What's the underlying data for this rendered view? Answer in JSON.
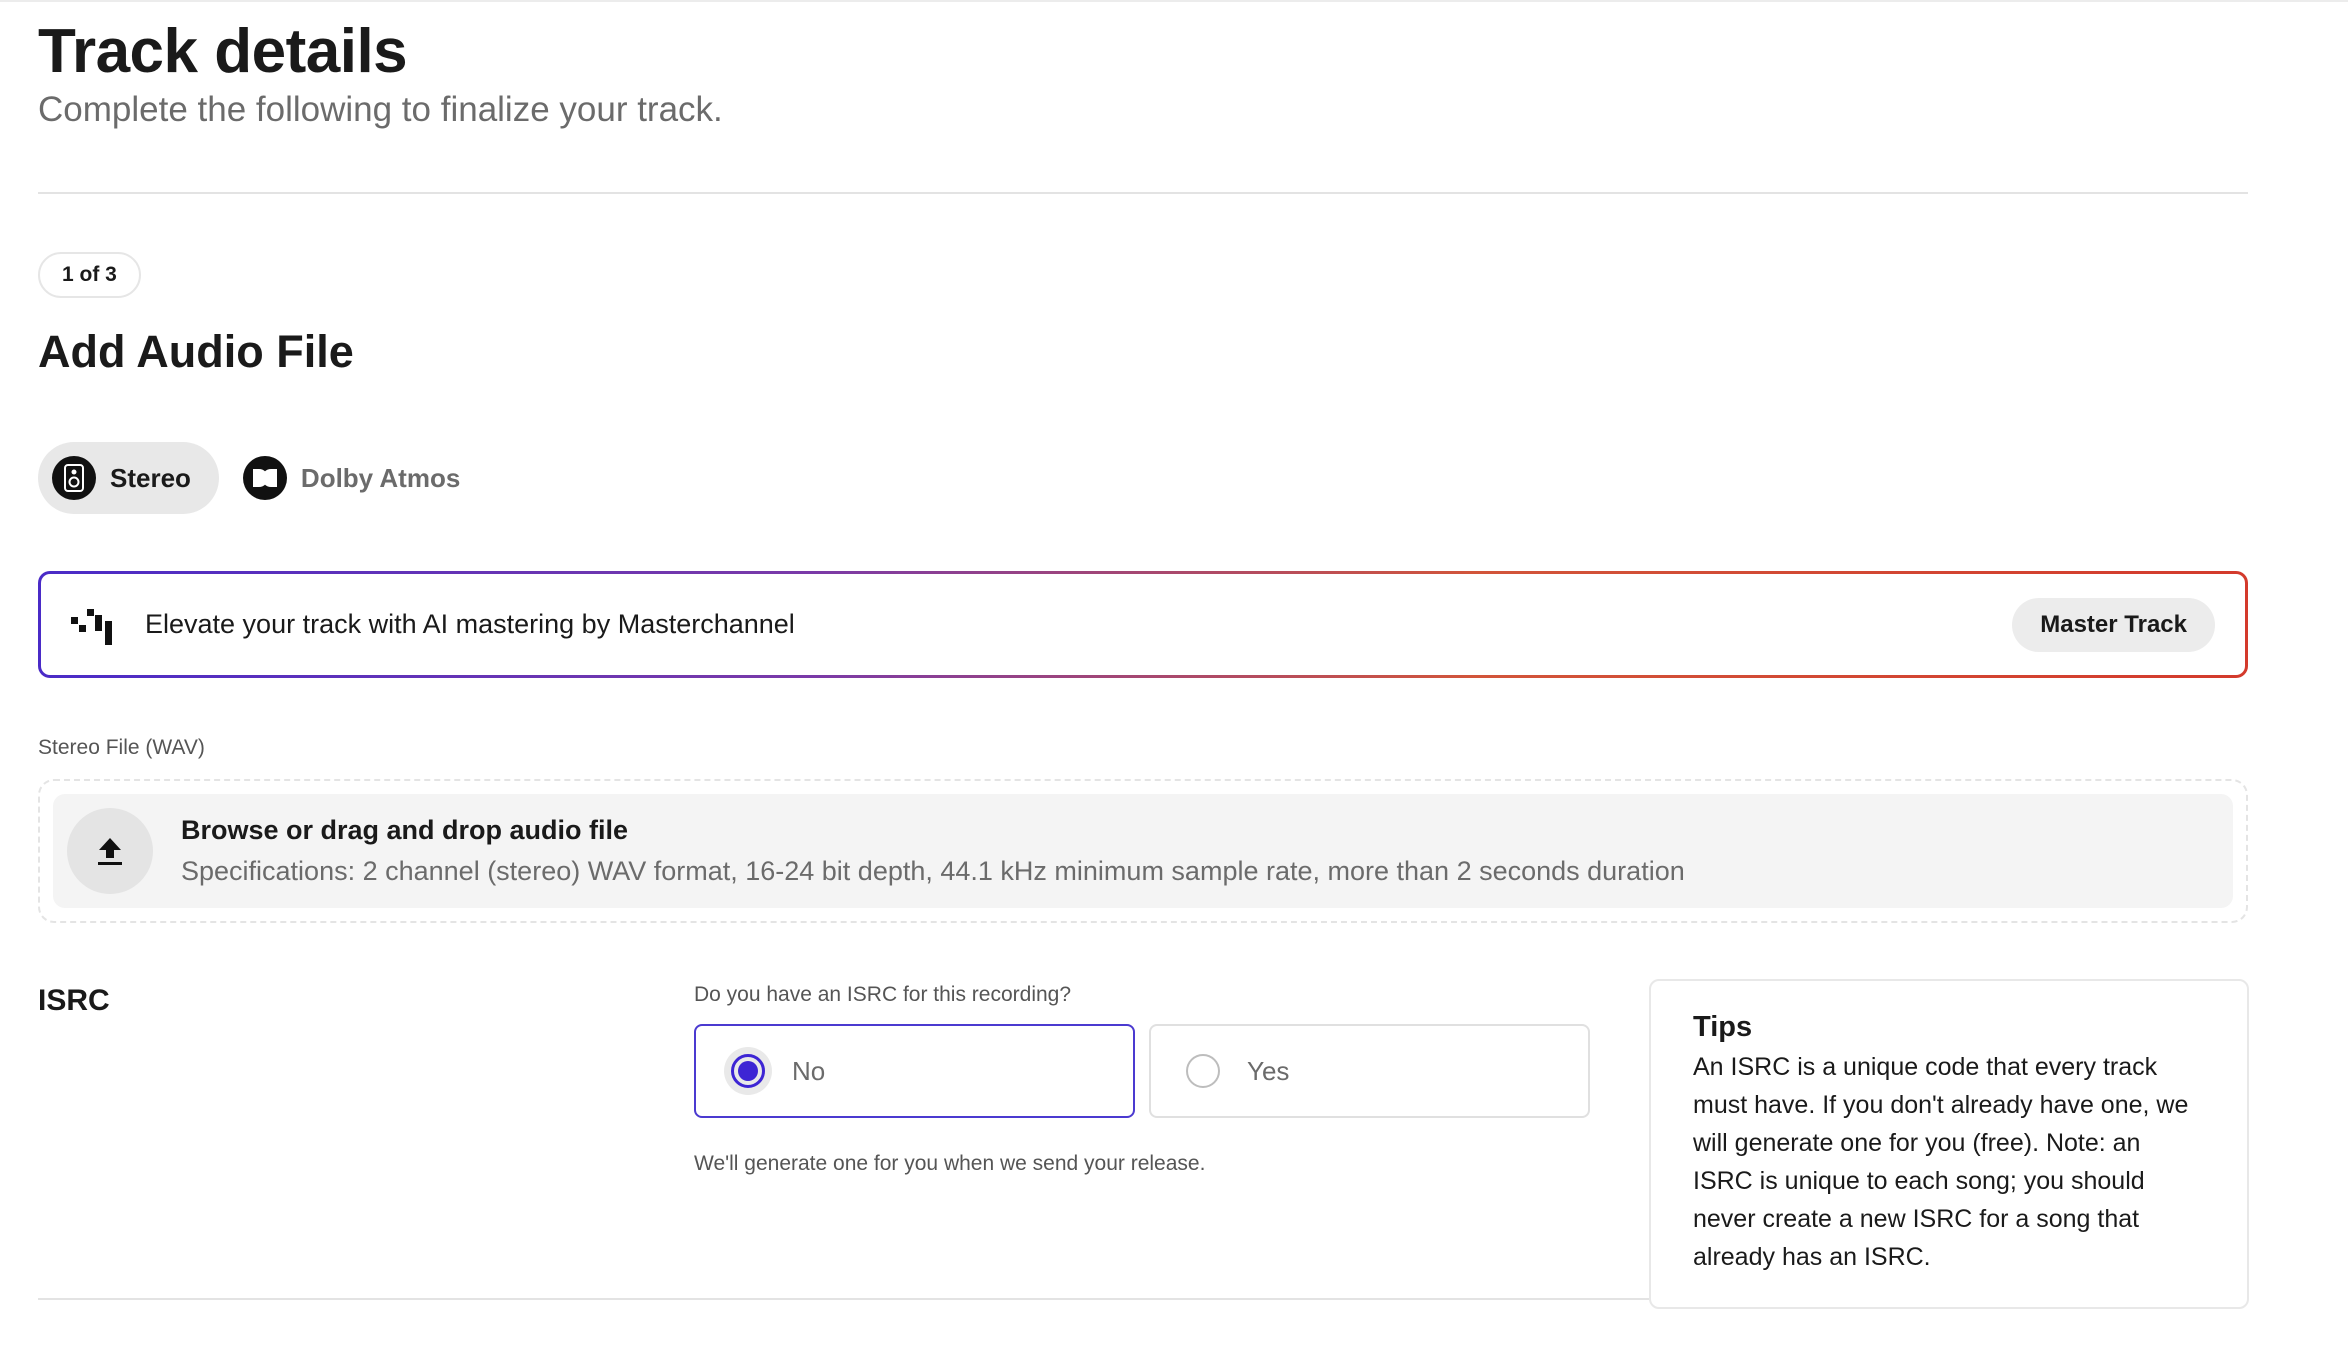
{
  "header": {
    "title": "Track details",
    "subtitle": "Complete the following to finalize your track."
  },
  "step": {
    "badge": "1 of 3",
    "title": "Add Audio File"
  },
  "format_toggle": {
    "selected": "Stereo",
    "options": [
      {
        "label": "Stereo",
        "icon": "speaker-icon"
      },
      {
        "label": "Dolby Atmos",
        "icon": "dolby-icon"
      }
    ]
  },
  "mastering_banner": {
    "icon": "masterchannel-logo-icon",
    "text": "Elevate your track with AI mastering by Masterchannel",
    "button_label": "Master Track",
    "gradient_colors": [
      "#4a2bc7",
      "#d33a2c"
    ]
  },
  "upload": {
    "field_label": "Stereo File (WAV)",
    "title": "Browse or drag and drop audio file",
    "specs": "Specifications: 2 channel (stereo) WAV format, 16-24 bit depth, 44.1 kHz minimum sample rate, more than 2 seconds duration",
    "icon": "upload-icon"
  },
  "isrc": {
    "heading": "ISRC",
    "question": "Do you have an ISRC for this recording?",
    "options": [
      {
        "label": "No",
        "selected": true
      },
      {
        "label": "Yes",
        "selected": false
      }
    ],
    "note": "We'll generate one for you when we send your release.",
    "accent_color": "#3d25d4"
  },
  "tips": {
    "title": "Tips",
    "body": "An ISRC is a unique code that every track must have. If you don't already have one, we will generate one for you (free). Note: an ISRC is unique to each song; you should never create a new ISRC for a song that already has an ISRC."
  }
}
